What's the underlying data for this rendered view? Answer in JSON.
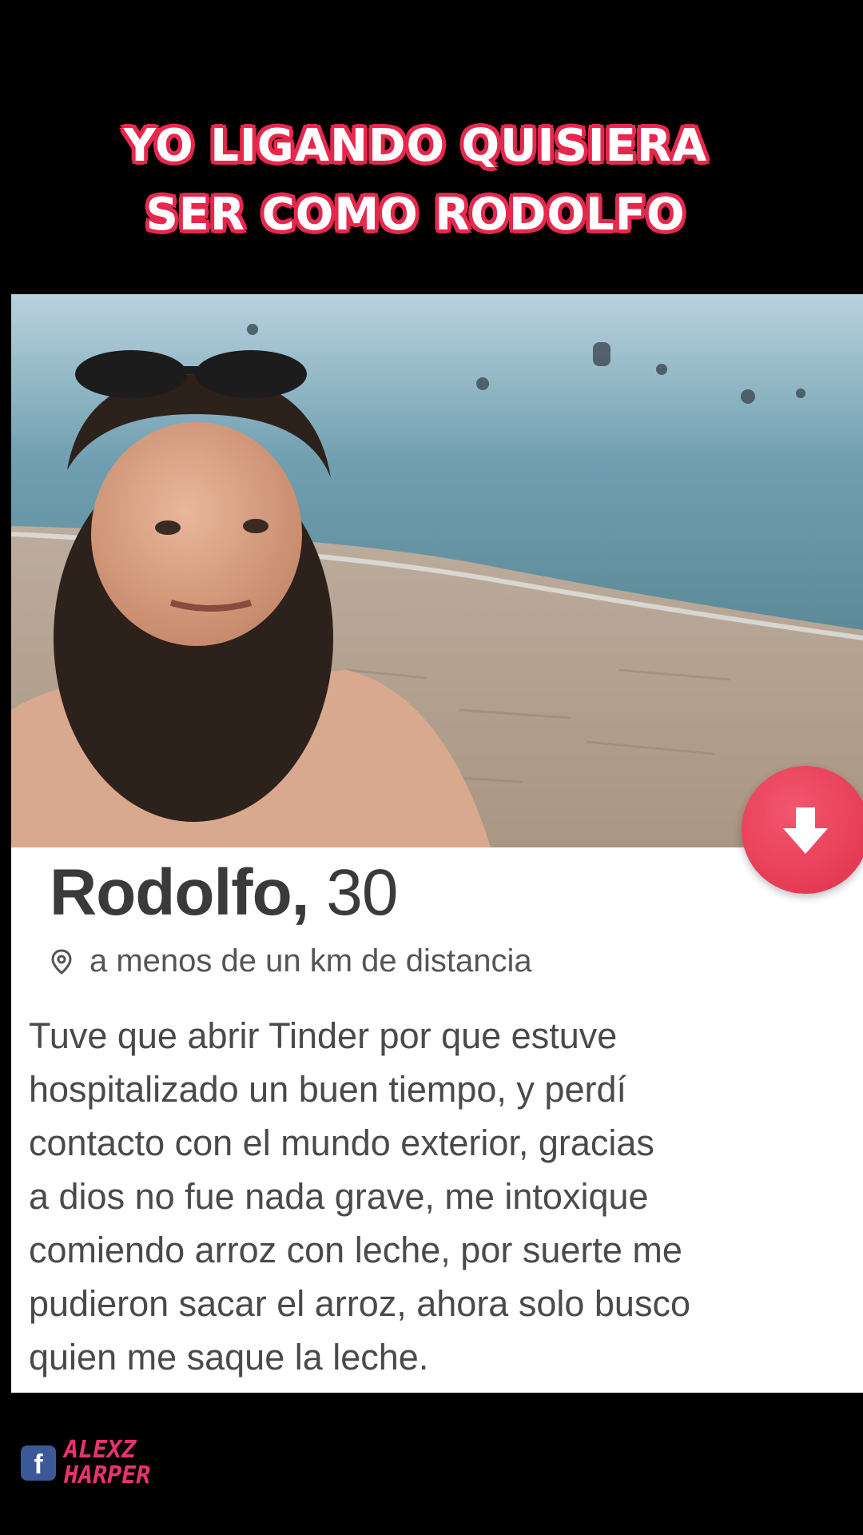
{
  "caption": {
    "line1": "YO LIGANDO QUISIERA",
    "line2": "SER COMO RODOLFO"
  },
  "profile": {
    "name": "Rodolfo,",
    "age": "30",
    "distance": "a menos de un km de distancia",
    "bio_lines": [
      "Tuve que abrir Tinder por que estuve",
      "hospitalizado un buen tiempo, y perdí",
      "contacto con el mundo exterior, gracias",
      "a dios no fue nada grave, me intoxique",
      "comiendo arroz con leche, por suerte me",
      "pudieron sacar el arroz, ahora solo busco",
      "quien me saque la leche."
    ]
  },
  "icons": {
    "nope": "arrow-down-icon",
    "location": "location-pin-icon",
    "facebook": "facebook-icon"
  },
  "colors": {
    "accent": "#e8274d",
    "button": "#e0304b"
  },
  "watermark": {
    "fb_glyph": "f",
    "line1": "ALEXZ",
    "line2": "HARPER"
  }
}
